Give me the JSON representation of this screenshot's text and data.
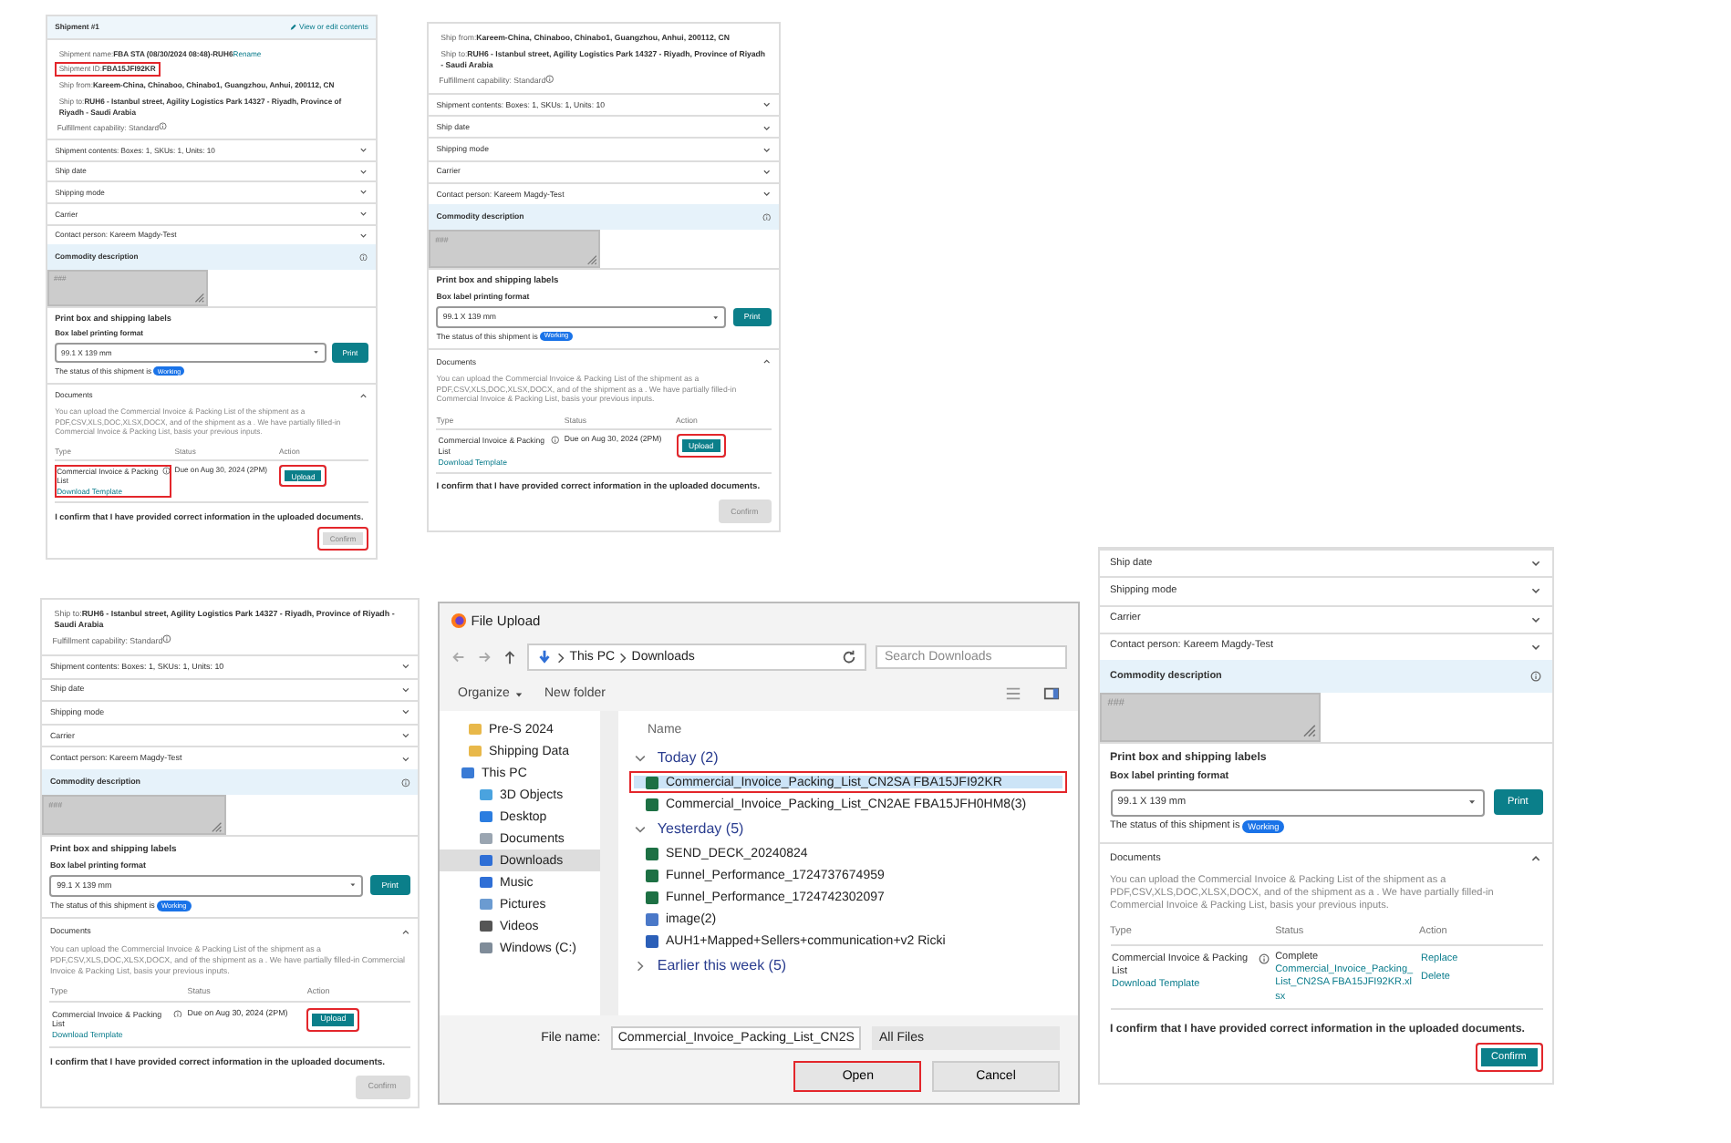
{
  "panels": [
    {
      "kind": "shipment",
      "header": {
        "title": "Shipment #1",
        "link": "View or edit contents"
      },
      "details": [
        {
          "label": "Shipment name:",
          "value": "FBA STA (08/30/2024 08:48)-RUH6",
          "link": "Rename",
          "highlighted": false
        },
        {
          "label": "Shipment ID:",
          "value": "FBA15JFI92KR",
          "highlighted": true
        },
        {
          "label": "Ship from:",
          "value": "Kareem-China, Chinaboo, Chinabo1, Guangzhou, Anhui, 200112, CN",
          "highlighted": false
        },
        {
          "label": "Ship to:",
          "value": "RUH6 - Istanbul street, Agility Logistics Park 14327 - Riyadh, Province of Riyadh - Saudi Arabia",
          "highlighted": false
        }
      ],
      "fulfillment": "Fulfillment capability: Standard",
      "accordions": [
        {
          "label": "Shipment contents: Boxes: 1, SKUs: 1, Units: 10",
          "expanded": false
        },
        {
          "label": "Ship date",
          "expanded": false
        },
        {
          "label": "Shipping mode",
          "expanded": false
        },
        {
          "label": "Carrier",
          "expanded": false
        },
        {
          "label": "Contact person: Kareem Magdy-Test",
          "expanded": false
        }
      ],
      "commodity": {
        "title": "Commodity description",
        "placeholder": "###"
      },
      "print": {
        "title": "Print box and shipping labels",
        "format_label": "Box label printing format",
        "format_value": "99.1 X 139 mm",
        "button": "Print",
        "status_text": "The status of this shipment is",
        "status_badge": "Working"
      },
      "documents": {
        "title": "Documents",
        "expanded": true,
        "description": "You can upload the Commercial Invoice & Packing List of the shipment as a PDF,CSV,XLS,DOC,XLSX,DOCX, and of the shipment as a . We have partially filled-in Commercial Invoice & Packing List, basis your previous inputs.",
        "columns": [
          "Type",
          "Status",
          "Action"
        ],
        "type_name": "Commercial Invoice & Packing List",
        "type_link": "Download Template",
        "type_highlighted": true,
        "status": "Due on Aug 30, 2024 (2PM)",
        "actions": [
          {
            "kind": "button",
            "label": "Upload",
            "highlighted": true
          }
        ]
      },
      "confirm": {
        "text": "I confirm that I have provided correct information in the uploaded documents.",
        "button": "Confirm",
        "enabled": false,
        "highlighted": true
      }
    },
    {
      "kind": "shipment",
      "details": [
        {
          "label": "Ship from:",
          "value": "Kareem-China, Chinaboo, Chinabo1, Guangzhou, Anhui, 200112, CN",
          "highlighted": false
        },
        {
          "label": "Ship to:",
          "value": "RUH6 - Istanbul street, Agility Logistics Park 14327 - Riyadh, Province of Riyadh - Saudi Arabia",
          "highlighted": false
        }
      ],
      "fulfillment": "Fulfillment capability: Standard",
      "accordions": [
        {
          "label": "Shipment contents: Boxes: 1, SKUs: 1, Units: 10",
          "expanded": false
        },
        {
          "label": "Ship date",
          "expanded": false
        },
        {
          "label": "Shipping mode",
          "expanded": false
        },
        {
          "label": "Carrier",
          "expanded": false
        },
        {
          "label": "Contact person: Kareem Magdy-Test",
          "expanded": false
        }
      ],
      "commodity": {
        "title": "Commodity description",
        "placeholder": "###"
      },
      "print": {
        "title": "Print box and shipping labels",
        "format_label": "Box label printing format",
        "format_value": "99.1 X 139 mm",
        "button": "Print",
        "status_text": "The status of this shipment is",
        "status_badge": "Working"
      },
      "documents": {
        "title": "Documents",
        "expanded": true,
        "description": "You can upload the Commercial Invoice & Packing List of the shipment as a PDF,CSV,XLS,DOC,XLSX,DOCX, and of the shipment as a . We have partially filled-in Commercial Invoice & Packing List, basis your previous inputs.",
        "columns": [
          "Type",
          "Status",
          "Action"
        ],
        "type_name": "Commercial Invoice & Packing List",
        "type_link": "Download Template",
        "type_highlighted": false,
        "status": "Due on Aug 30, 2024 (2PM)",
        "actions": [
          {
            "kind": "button",
            "label": "Upload",
            "highlighted": true
          }
        ]
      },
      "confirm": {
        "text": "I confirm that I have provided correct information in the uploaded documents.",
        "button": "Confirm",
        "enabled": false,
        "highlighted": false
      }
    },
    {
      "kind": "shipment",
      "details": [
        {
          "label": "Ship to:",
          "value": "RUH6 - Istanbul street, Agility Logistics Park 14327 - Riyadh, Province of Riyadh - Saudi Arabia",
          "highlighted": false
        }
      ],
      "fulfillment": "Fulfillment capability: Standard",
      "accordions": [
        {
          "label": "Shipment contents: Boxes: 1, SKUs: 1, Units: 10",
          "expanded": false
        },
        {
          "label": "Ship date",
          "expanded": false
        },
        {
          "label": "Shipping mode",
          "expanded": false
        },
        {
          "label": "Carrier",
          "expanded": false
        },
        {
          "label": "Contact person: Kareem Magdy-Test",
          "expanded": false
        }
      ],
      "commodity": {
        "title": "Commodity description",
        "placeholder": "###"
      },
      "print": {
        "title": "Print box and shipping labels",
        "format_label": "Box label printing format",
        "format_value": "99.1 X 139 mm",
        "button": "Print",
        "status_text": "The status of this shipment is",
        "status_badge": "Working"
      },
      "documents": {
        "title": "Documents",
        "expanded": true,
        "description": "You can upload the Commercial Invoice & Packing List of the shipment as a PDF,CSV,XLS,DOC,XLSX,DOCX, and of the shipment as a . We have partially filled-in Commercial Invoice & Packing List, basis your previous inputs.",
        "columns": [
          "Type",
          "Status",
          "Action"
        ],
        "type_name": "Commercial Invoice & Packing List",
        "type_link": "Download Template",
        "type_highlighted": false,
        "status": "Due on Aug 30, 2024 (2PM)",
        "actions": [
          {
            "kind": "button",
            "label": "Upload",
            "highlighted": true
          }
        ]
      },
      "confirm": {
        "text": "I confirm that I have provided correct information in the uploaded documents.",
        "button": "Confirm",
        "enabled": false,
        "highlighted": false
      }
    },
    {
      "kind": "file_dialog",
      "title": "File Upload",
      "path": [
        "This PC",
        "Downloads"
      ],
      "search_placeholder": "Search Downloads",
      "toolbar": [
        {
          "label": "Organize",
          "dropdown": true
        },
        {
          "label": "New folder",
          "dropdown": false
        }
      ],
      "nav": [
        {
          "label": "Pre-S 2024",
          "kind": "folder",
          "selected": false
        },
        {
          "label": "Shipping Data",
          "kind": "folder",
          "selected": false
        },
        {
          "label": "This PC",
          "kind": "pc",
          "selected": false,
          "children": [
            {
              "label": "3D Objects",
              "kind": "cube",
              "selected": false
            },
            {
              "label": "Desktop",
              "kind": "desktop",
              "selected": false
            },
            {
              "label": "Documents",
              "kind": "documents",
              "selected": false
            },
            {
              "label": "Downloads",
              "kind": "downloads",
              "selected": true
            },
            {
              "label": "Music",
              "kind": "music",
              "selected": false
            },
            {
              "label": "Pictures",
              "kind": "pictures",
              "selected": false
            },
            {
              "label": "Videos",
              "kind": "videos",
              "selected": false
            },
            {
              "label": "Windows (C:)",
              "kind": "drive",
              "selected": false
            }
          ]
        }
      ],
      "column": "Name",
      "groups": [
        {
          "label": "Today (2)",
          "expanded": true,
          "files": [
            {
              "name": "Commercial_Invoice_Packing_List_CN2SA FBA15JFI92KR",
              "kind": "excel",
              "selected": true,
              "highlighted": true
            },
            {
              "name": "Commercial_Invoice_Packing_List_CN2AE FBA15JFH0HM8(3)",
              "kind": "excel",
              "selected": false,
              "highlighted": false
            }
          ]
        },
        {
          "label": "Yesterday (5)",
          "expanded": true,
          "files": [
            {
              "name": "SEND_DECK_20240824",
              "kind": "excel",
              "selected": false,
              "highlighted": false
            },
            {
              "name": "Funnel_Performance_1724737674959",
              "kind": "excel",
              "selected": false,
              "highlighted": false
            },
            {
              "name": "Funnel_Performance_1724742302097",
              "kind": "excel",
              "selected": false,
              "highlighted": false
            },
            {
              "name": "image(2)",
              "kind": "image",
              "selected": false,
              "highlighted": false
            },
            {
              "name": "AUH1+Mapped+Sellers+communication+v2 Ricki",
              "kind": "word",
              "selected": false,
              "highlighted": false
            }
          ]
        },
        {
          "label": "Earlier this week (5)",
          "expanded": false
        }
      ],
      "file_name_label": "File name:",
      "file_name_value": "Commercial_Invoice_Packing_List_CN2S",
      "filter": "All Files",
      "buttons": [
        {
          "label": "Open",
          "primary": true,
          "highlighted": true
        },
        {
          "label": "Cancel",
          "primary": false,
          "highlighted": false
        }
      ]
    },
    {
      "kind": "shipment",
      "accordions": [
        {
          "label": "Ship date",
          "expanded": false
        },
        {
          "label": "Shipping mode",
          "expanded": false
        },
        {
          "label": "Carrier",
          "expanded": false
        },
        {
          "label": "Contact person: Kareem Magdy-Test",
          "expanded": false
        }
      ],
      "commodity": {
        "title": "Commodity description",
        "placeholder": "###"
      },
      "print": {
        "title": "Print box and shipping labels",
        "format_label": "Box label printing format",
        "format_value": "99.1 X 139 mm",
        "button": "Print",
        "status_text": "The status of this shipment is",
        "status_badge": "Working"
      },
      "documents": {
        "title": "Documents",
        "expanded": true,
        "description": "You can upload the Commercial Invoice & Packing List of the shipment as a PDF,CSV,XLS,DOC,XLSX,DOCX, and of the shipment as a . We have partially filled-in Commercial Invoice & Packing List, basis your previous inputs.",
        "columns": [
          "Type",
          "Status",
          "Action"
        ],
        "type_name": "Commercial Invoice & Packing List",
        "type_link": "Download Template",
        "type_highlighted": false,
        "status": "Complete",
        "status_link": "Commercial_Invoice_Packing_List_CN2SA FBA15JFI92KR.xlsx",
        "actions": [
          {
            "kind": "link",
            "label": "Replace",
            "highlighted": false
          },
          {
            "kind": "link",
            "label": "Delete",
            "highlighted": false
          }
        ]
      },
      "confirm": {
        "text": "I confirm that I have provided correct information in the uploaded documents.",
        "button": "Confirm",
        "enabled": true,
        "highlighted": true
      }
    }
  ]
}
